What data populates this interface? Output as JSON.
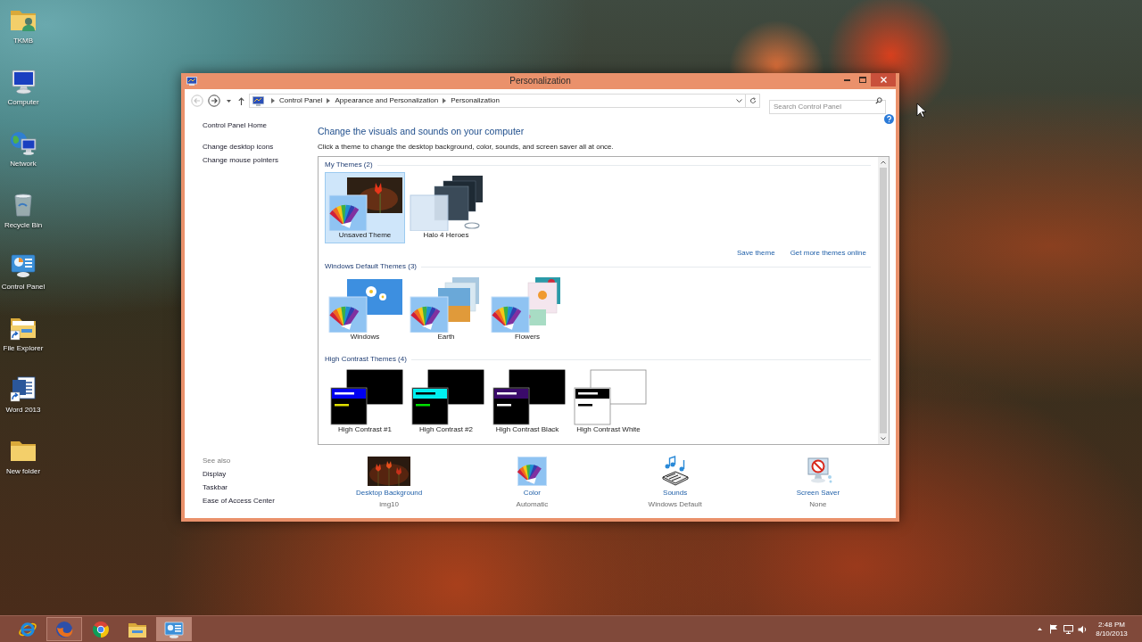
{
  "desktop": {
    "icons": [
      {
        "label": "TKMB",
        "kind": "userfolder"
      },
      {
        "label": "Computer",
        "kind": "computer"
      },
      {
        "label": "Network",
        "kind": "network"
      },
      {
        "label": "Recycle Bin",
        "kind": "recyclebin"
      },
      {
        "label": "Control Panel",
        "kind": "controlpanel"
      },
      {
        "label": "File Explorer",
        "kind": "explorer"
      },
      {
        "label": "Word 2013",
        "kind": "word"
      },
      {
        "label": "New folder",
        "kind": "folder"
      }
    ]
  },
  "window": {
    "title": "Personalization",
    "navigation": {
      "back": {
        "disabled": true
      },
      "forward": {
        "disabled": false
      }
    },
    "address_bar": {
      "breadcrumbs": [
        "Control Panel",
        "Appearance and Personalization",
        "Personalization"
      ]
    },
    "search": {
      "placeholder": "Search Control Panel"
    },
    "sidebar": {
      "items": [
        "Control Panel Home",
        "Change desktop icons",
        "Change mouse pointers"
      ],
      "see_also": {
        "heading": "See also",
        "items": [
          "Display",
          "Taskbar",
          "Ease of Access Center"
        ]
      }
    },
    "heading": "Change the visuals and sounds on your computer",
    "description": "Click a theme to change the desktop background, color, sounds, and screen saver all at once.",
    "theme_groups": [
      {
        "title": "My Themes (2)",
        "themes": [
          {
            "name": "Unsaved Theme",
            "kind": "custom",
            "selected": true
          },
          {
            "name": "Halo 4 Heroes",
            "kind": "halo",
            "selected": false
          }
        ],
        "links": [
          "Save theme",
          "Get more themes online"
        ]
      },
      {
        "title": "Windows Default Themes (3)",
        "themes": [
          {
            "name": "Windows",
            "kind": "windows",
            "selected": false
          },
          {
            "name": "Earth",
            "kind": "earth",
            "selected": false
          },
          {
            "name": "Flowers",
            "kind": "flowers",
            "selected": false
          }
        ]
      },
      {
        "title": "High Contrast Themes (4)",
        "themes": [
          {
            "name": "High Contrast #1",
            "kind": "contrast1",
            "selected": false
          },
          {
            "name": "High Contrast #2",
            "kind": "contrast2",
            "selected": false
          },
          {
            "name": "High Contrast Black",
            "kind": "contrastblack",
            "selected": false
          },
          {
            "name": "High Contrast White",
            "kind": "contrastwhite",
            "selected": false
          }
        ]
      }
    ],
    "settings": [
      {
        "label": "Desktop Background",
        "value": "img10",
        "kind": "background"
      },
      {
        "label": "Color",
        "value": "Automatic",
        "kind": "color"
      },
      {
        "label": "Sounds",
        "value": "Windows Default",
        "kind": "sounds"
      },
      {
        "label": "Screen Saver",
        "value": "None",
        "kind": "screensaver"
      }
    ]
  },
  "taskbar": {
    "apps": [
      {
        "kind": "ebrowser",
        "running": false,
        "selected": false
      },
      {
        "kind": "foxbrowser",
        "running": true,
        "selected": false
      },
      {
        "kind": "roundbrowser",
        "running": false,
        "selected": false
      },
      {
        "kind": "folder",
        "running": false,
        "selected": false
      },
      {
        "kind": "controlpanel",
        "running": true,
        "selected": true
      }
    ],
    "clock": {
      "time": "2:48 PM",
      "date": "8/10/2013"
    }
  }
}
